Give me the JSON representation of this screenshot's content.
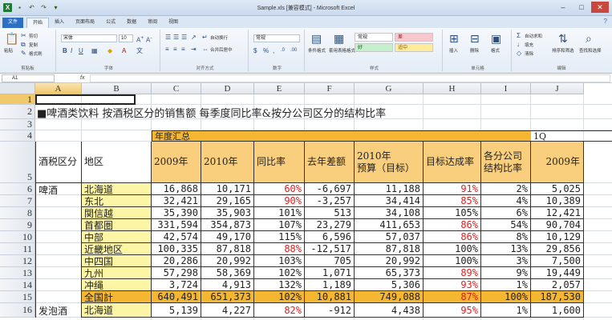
{
  "window": {
    "title": "Sample.xls [兼容模式] - Microsoft Excel",
    "help_icon": "help-icon"
  },
  "ribbon": {
    "tabs": [
      "文件",
      "开始",
      "插入",
      "页面布局",
      "公式",
      "数据",
      "审阅",
      "视图"
    ],
    "clipboard": {
      "label": "剪贴板",
      "paste": "粘贴",
      "cut": "剪切",
      "copy": "复制",
      "format_painter": "格式刷"
    },
    "font": {
      "label": "字体",
      "name": "宋体",
      "size": "10",
      "bold": "B",
      "italic": "I",
      "underline": "U"
    },
    "alignment": {
      "label": "对齐方式",
      "wrap": "自动换行",
      "merge": "合并后居中"
    },
    "number": {
      "label": "数字",
      "format": "常规",
      "percent": "%",
      "comma": ","
    },
    "styles": {
      "label": "样式",
      "conditional": "条件格式",
      "table": "套用表格格式",
      "normal": "常规",
      "bad": "差",
      "good": "好",
      "neutral": "适中"
    },
    "cells": {
      "label": "单元格",
      "insert": "插入",
      "delete": "删除",
      "format": "格式"
    },
    "editing": {
      "label": "编辑",
      "autosum": "自动求和",
      "fill": "填充",
      "clear": "清除",
      "sort": "排序和筛选",
      "find": "查找和选择"
    }
  },
  "formula_bar": {
    "name_box": "A1",
    "fx": "fx",
    "value": ""
  },
  "sheet": {
    "columns": [
      "A",
      "B",
      "C",
      "D",
      "E",
      "F",
      "G",
      "H",
      "I",
      "J"
    ],
    "rows": [
      "1",
      "2",
      "3",
      "4",
      "5",
      "6",
      "7",
      "8",
      "9",
      "10",
      "11",
      "12",
      "13",
      "14",
      "15",
      "16"
    ],
    "title": "■啤酒类饮料 按酒税区分的销售额 每季度同比率&按分公司区分的结构比率",
    "group_header": "年度汇总",
    "q_header": "1Q",
    "headers": [
      "酒税区分",
      "地区",
      "2009年",
      "2010年",
      "同比率",
      "去年差额",
      "2010年\n预算（目标）",
      "目标达成率",
      "各分公司\n结构比率",
      "2009年"
    ],
    "category_beer": "啤酒",
    "category_happoshu": "发泡酒",
    "data": [
      [
        "北海道",
        "16,868",
        "10,171",
        "60%",
        "-6,697",
        "11,188",
        "91%",
        "2%",
        "5,025"
      ],
      [
        "东北",
        "32,421",
        "29,165",
        "90%",
        "-3,257",
        "34,414",
        "85%",
        "4%",
        "10,389"
      ],
      [
        "関信越",
        "35,390",
        "35,903",
        "101%",
        "513",
        "34,108",
        "105%",
        "6%",
        "12,421"
      ],
      [
        "首都圏",
        "331,594",
        "354,873",
        "107%",
        "23,279",
        "411,653",
        "86%",
        "54%",
        "90,704"
      ],
      [
        "中部",
        "42,574",
        "49,170",
        "115%",
        "6,596",
        "57,037",
        "86%",
        "8%",
        "10,129"
      ],
      [
        "近畿地区",
        "100,335",
        "87,818",
        "88%",
        "-12,517",
        "87,818",
        "100%",
        "13%",
        "29,856"
      ],
      [
        "中四国",
        "20,286",
        "20,992",
        "103%",
        "705",
        "20,992",
        "100%",
        "3%",
        "7,500"
      ],
      [
        "九州",
        "57,298",
        "58,369",
        "102%",
        "1,071",
        "65,373",
        "89%",
        "9%",
        "19,449"
      ],
      [
        "冲绳",
        "3,724",
        "4,913",
        "132%",
        "1,189",
        "5,306",
        "93%",
        "1%",
        "2,057"
      ],
      [
        "全国計",
        "640,491",
        "651,373",
        "102%",
        "10,881",
        "749,088",
        "87%",
        "100%",
        "187,530"
      ],
      [
        "北海道",
        "5,139",
        "4,227",
        "82%",
        "-912",
        "4,438",
        "95%",
        "1%",
        "1,600"
      ]
    ],
    "red_flags": [
      [
        true,
        true
      ],
      [
        true,
        true
      ],
      [
        false,
        false
      ],
      [
        false,
        true
      ],
      [
        false,
        true
      ],
      [
        true,
        false
      ],
      [
        false,
        false
      ],
      [
        false,
        true
      ],
      [
        false,
        true
      ],
      [
        false,
        true
      ],
      [
        true,
        true
      ]
    ],
    "colors": {
      "yellow": "#fdf5a6",
      "orange": "#f9cf7e",
      "gold": "#f5b631",
      "red": "#e21d1d"
    }
  }
}
